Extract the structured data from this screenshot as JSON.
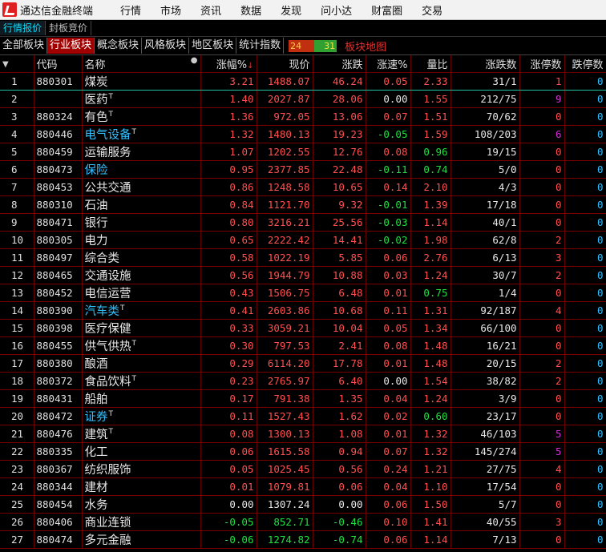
{
  "menubar": {
    "app_name": "通达信金融终端",
    "items": [
      "行情",
      "市场",
      "资讯",
      "数据",
      "发现",
      "问小达",
      "财富圈",
      "交易"
    ]
  },
  "tabs1": [
    "行情报价",
    "封板竞价"
  ],
  "tabs2": {
    "items": [
      "全部板块",
      "行业板块",
      "概念板块",
      "风格板块",
      "地区板块",
      "统计指数"
    ],
    "active": 1,
    "advance_count": "24",
    "decline_count": "31",
    "map_label": "板块地图"
  },
  "columns": [
    "",
    "代码",
    "名称",
    "涨幅%",
    "现价",
    "涨跌",
    "涨速%",
    "量比",
    "涨跌数",
    "涨停数",
    "跌停数"
  ],
  "colors": {
    "up": "#ff5050",
    "down": "#20e040",
    "flat": "#e8e8e8",
    "highlight_name": "#30c0ff",
    "limit_count": "#d030d0"
  },
  "rows": [
    {
      "idx": "1",
      "code": "880301",
      "name": "煤炭",
      "tag": "",
      "pct": "3.21",
      "price": "1488.07",
      "chg": "46.24",
      "spd": "0.05",
      "vr": "2.33",
      "ud": "31/1",
      "lu": "1",
      "ld": "0",
      "name_c": "white",
      "spd_c": "red",
      "vr_c": "red",
      "lu_c": "red"
    },
    {
      "idx": "2",
      "code": "",
      "name": "医药",
      "tag": "T",
      "pct": "1.40",
      "price": "2027.87",
      "chg": "28.06",
      "spd": "0.00",
      "vr": "1.55",
      "ud": "212/75",
      "lu": "9",
      "ld": "0",
      "name_c": "white",
      "spd_c": "white",
      "vr_c": "red",
      "lu_c": "magenta"
    },
    {
      "idx": "3",
      "code": "880324",
      "name": "有色",
      "tag": "T",
      "pct": "1.36",
      "price": "972.05",
      "chg": "13.06",
      "spd": "0.07",
      "vr": "1.51",
      "ud": "70/62",
      "lu": "0",
      "ld": "0",
      "name_c": "white",
      "spd_c": "red",
      "vr_c": "red",
      "lu_c": "red"
    },
    {
      "idx": "4",
      "code": "880446",
      "name": "电气设备",
      "tag": "T",
      "pct": "1.32",
      "price": "1480.13",
      "chg": "19.23",
      "spd": "-0.05",
      "vr": "1.59",
      "ud": "108/203",
      "lu": "6",
      "ld": "0",
      "name_c": "cyan",
      "spd_c": "green",
      "vr_c": "red",
      "lu_c": "magenta"
    },
    {
      "idx": "5",
      "code": "880459",
      "name": "运输服务",
      "tag": "",
      "pct": "1.07",
      "price": "1202.55",
      "chg": "12.76",
      "spd": "0.08",
      "vr": "0.96",
      "ud": "19/15",
      "lu": "0",
      "ld": "0",
      "name_c": "white",
      "spd_c": "red",
      "vr_c": "green",
      "lu_c": "red"
    },
    {
      "idx": "6",
      "code": "880473",
      "name": "保险",
      "tag": "",
      "pct": "0.95",
      "price": "2377.85",
      "chg": "22.48",
      "spd": "-0.11",
      "vr": "0.74",
      "ud": "5/0",
      "lu": "0",
      "ld": "0",
      "name_c": "cyan",
      "spd_c": "green",
      "vr_c": "green",
      "lu_c": "red"
    },
    {
      "idx": "7",
      "code": "880453",
      "name": "公共交通",
      "tag": "",
      "pct": "0.86",
      "price": "1248.58",
      "chg": "10.65",
      "spd": "0.14",
      "vr": "2.10",
      "ud": "4/3",
      "lu": "0",
      "ld": "0",
      "name_c": "white",
      "spd_c": "red",
      "vr_c": "red",
      "lu_c": "red"
    },
    {
      "idx": "8",
      "code": "880310",
      "name": "石油",
      "tag": "",
      "pct": "0.84",
      "price": "1121.70",
      "chg": "9.32",
      "spd": "-0.01",
      "vr": "1.39",
      "ud": "17/18",
      "lu": "0",
      "ld": "0",
      "name_c": "white",
      "spd_c": "green",
      "vr_c": "red",
      "lu_c": "red"
    },
    {
      "idx": "9",
      "code": "880471",
      "name": "银行",
      "tag": "",
      "pct": "0.80",
      "price": "3216.21",
      "chg": "25.56",
      "spd": "-0.03",
      "vr": "1.14",
      "ud": "40/1",
      "lu": "0",
      "ld": "0",
      "name_c": "white",
      "spd_c": "green",
      "vr_c": "red",
      "lu_c": "red"
    },
    {
      "idx": "10",
      "code": "880305",
      "name": "电力",
      "tag": "",
      "pct": "0.65",
      "price": "2222.42",
      "chg": "14.41",
      "spd": "-0.02",
      "vr": "1.98",
      "ud": "62/8",
      "lu": "2",
      "ld": "0",
      "name_c": "white",
      "spd_c": "green",
      "vr_c": "red",
      "lu_c": "red"
    },
    {
      "idx": "11",
      "code": "880497",
      "name": "综合类",
      "tag": "",
      "pct": "0.58",
      "price": "1022.19",
      "chg": "5.85",
      "spd": "0.06",
      "vr": "2.76",
      "ud": "6/13",
      "lu": "3",
      "ld": "0",
      "name_c": "white",
      "spd_c": "red",
      "vr_c": "red",
      "lu_c": "red"
    },
    {
      "idx": "12",
      "code": "880465",
      "name": "交通设施",
      "tag": "",
      "pct": "0.56",
      "price": "1944.79",
      "chg": "10.88",
      "spd": "0.03",
      "vr": "1.24",
      "ud": "30/7",
      "lu": "2",
      "ld": "0",
      "name_c": "white",
      "spd_c": "red",
      "vr_c": "red",
      "lu_c": "red"
    },
    {
      "idx": "13",
      "code": "880452",
      "name": "电信运营",
      "tag": "",
      "pct": "0.43",
      "price": "1506.75",
      "chg": "6.48",
      "spd": "0.01",
      "vr": "0.75",
      "ud": "1/4",
      "lu": "0",
      "ld": "0",
      "name_c": "white",
      "spd_c": "red",
      "vr_c": "green",
      "lu_c": "red"
    },
    {
      "idx": "14",
      "code": "880390",
      "name": "汽车类",
      "tag": "T",
      "pct": "0.41",
      "price": "2603.86",
      "chg": "10.68",
      "spd": "0.11",
      "vr": "1.31",
      "ud": "92/187",
      "lu": "4",
      "ld": "0",
      "name_c": "cyan",
      "spd_c": "red",
      "vr_c": "red",
      "lu_c": "red"
    },
    {
      "idx": "15",
      "code": "880398",
      "name": "医疗保健",
      "tag": "",
      "pct": "0.33",
      "price": "3059.21",
      "chg": "10.04",
      "spd": "0.05",
      "vr": "1.34",
      "ud": "66/100",
      "lu": "0",
      "ld": "0",
      "name_c": "white",
      "spd_c": "red",
      "vr_c": "red",
      "lu_c": "red"
    },
    {
      "idx": "16",
      "code": "880455",
      "name": "供气供热",
      "tag": "T",
      "pct": "0.30",
      "price": "797.53",
      "chg": "2.41",
      "spd": "0.08",
      "vr": "1.48",
      "ud": "16/21",
      "lu": "0",
      "ld": "0",
      "name_c": "white",
      "spd_c": "red",
      "vr_c": "red",
      "lu_c": "red"
    },
    {
      "idx": "17",
      "code": "880380",
      "name": "酿酒",
      "tag": "",
      "pct": "0.29",
      "price": "6114.20",
      "chg": "17.78",
      "spd": "0.01",
      "vr": "1.48",
      "ud": "20/15",
      "lu": "2",
      "ld": "0",
      "name_c": "white",
      "spd_c": "red",
      "vr_c": "red",
      "lu_c": "red"
    },
    {
      "idx": "18",
      "code": "880372",
      "name": "食品饮料",
      "tag": "T",
      "pct": "0.23",
      "price": "2765.97",
      "chg": "6.40",
      "spd": "0.00",
      "vr": "1.54",
      "ud": "38/82",
      "lu": "2",
      "ld": "0",
      "name_c": "white",
      "spd_c": "white",
      "vr_c": "red",
      "lu_c": "red"
    },
    {
      "idx": "19",
      "code": "880431",
      "name": "船舶",
      "tag": "",
      "pct": "0.17",
      "price": "791.38",
      "chg": "1.35",
      "spd": "0.04",
      "vr": "1.24",
      "ud": "3/9",
      "lu": "0",
      "ld": "0",
      "name_c": "white",
      "spd_c": "red",
      "vr_c": "red",
      "lu_c": "red"
    },
    {
      "idx": "20",
      "code": "880472",
      "name": "证券",
      "tag": "T",
      "pct": "0.11",
      "price": "1527.43",
      "chg": "1.62",
      "spd": "0.02",
      "vr": "0.60",
      "ud": "23/17",
      "lu": "0",
      "ld": "0",
      "name_c": "cyan",
      "spd_c": "red",
      "vr_c": "green",
      "lu_c": "red"
    },
    {
      "idx": "21",
      "code": "880476",
      "name": "建筑",
      "tag": "T",
      "pct": "0.08",
      "price": "1300.13",
      "chg": "1.08",
      "spd": "0.01",
      "vr": "1.32",
      "ud": "46/103",
      "lu": "5",
      "ld": "0",
      "name_c": "white",
      "spd_c": "red",
      "vr_c": "red",
      "lu_c": "magenta"
    },
    {
      "idx": "22",
      "code": "880335",
      "name": "化工",
      "tag": "",
      "pct": "0.06",
      "price": "1615.58",
      "chg": "0.94",
      "spd": "0.07",
      "vr": "1.32",
      "ud": "145/274",
      "lu": "5",
      "ld": "0",
      "name_c": "white",
      "spd_c": "red",
      "vr_c": "red",
      "lu_c": "magenta"
    },
    {
      "idx": "23",
      "code": "880367",
      "name": "纺织服饰",
      "tag": "",
      "pct": "0.05",
      "price": "1025.45",
      "chg": "0.56",
      "spd": "0.24",
      "vr": "1.21",
      "ud": "27/75",
      "lu": "4",
      "ld": "0",
      "name_c": "white",
      "spd_c": "red",
      "vr_c": "red",
      "lu_c": "red"
    },
    {
      "idx": "24",
      "code": "880344",
      "name": "建材",
      "tag": "",
      "pct": "0.01",
      "price": "1079.81",
      "chg": "0.06",
      "spd": "0.04",
      "vr": "1.10",
      "ud": "17/54",
      "lu": "0",
      "ld": "0",
      "name_c": "white",
      "spd_c": "red",
      "vr_c": "red",
      "lu_c": "red"
    },
    {
      "idx": "25",
      "code": "880454",
      "name": "水务",
      "tag": "",
      "pct": "0.00",
      "price": "1307.24",
      "chg": "0.00",
      "spd": "0.06",
      "vr": "1.50",
      "ud": "5/7",
      "lu": "0",
      "ld": "0",
      "name_c": "white",
      "spd_c": "red",
      "vr_c": "red",
      "lu_c": "red"
    },
    {
      "idx": "26",
      "code": "880406",
      "name": "商业连锁",
      "tag": "",
      "pct": "-0.05",
      "price": "852.71",
      "chg": "-0.46",
      "spd": "0.10",
      "vr": "1.41",
      "ud": "40/55",
      "lu": "3",
      "ld": "0",
      "name_c": "white",
      "spd_c": "red",
      "vr_c": "red",
      "lu_c": "red"
    },
    {
      "idx": "27",
      "code": "880474",
      "name": "多元金融",
      "tag": "",
      "pct": "-0.06",
      "price": "1274.82",
      "chg": "-0.74",
      "spd": "0.06",
      "vr": "1.14",
      "ud": "7/13",
      "lu": "0",
      "ld": "0",
      "name_c": "white",
      "spd_c": "red",
      "vr_c": "red",
      "lu_c": "red"
    }
  ]
}
